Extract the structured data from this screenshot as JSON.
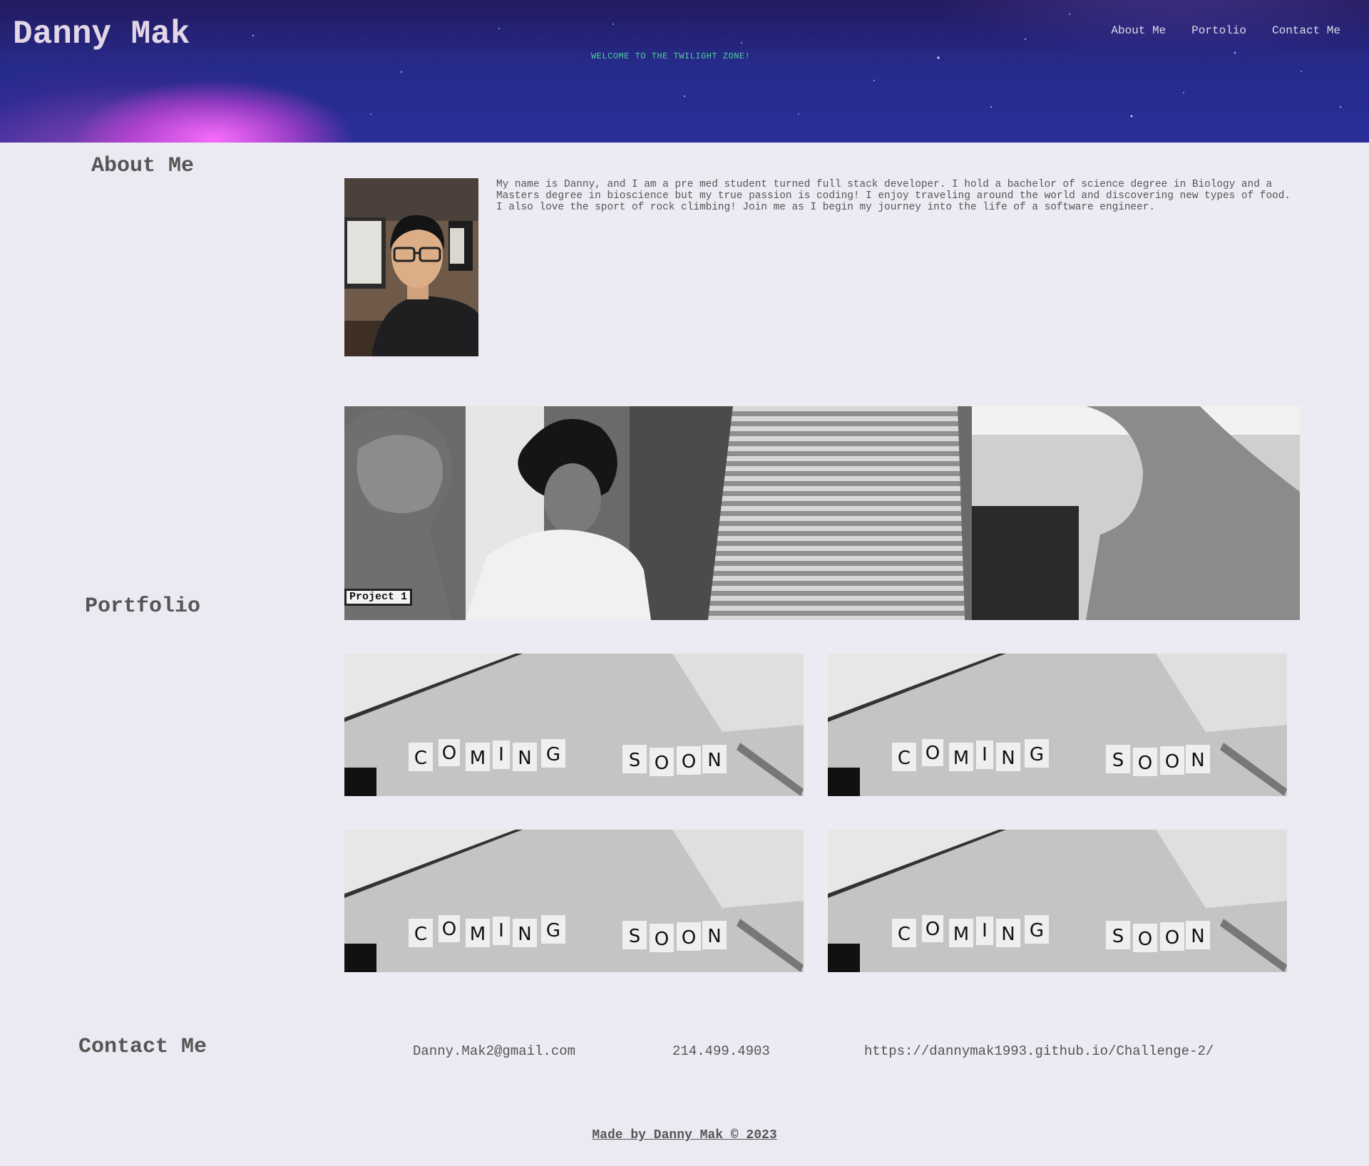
{
  "header": {
    "site_name": "Danny Mak",
    "tagline": "WELCOME TO THE TWILIGHT ZONE!",
    "nav": [
      {
        "label": "About Me"
      },
      {
        "label": "Portolio"
      },
      {
        "label": "Contact Me"
      }
    ]
  },
  "about": {
    "heading": "About Me",
    "bio": "My name is Danny, and I am a pre med student turned full stack developer. I hold a bachelor of science degree in Biology and a Masters degree in bioscience but my true passion is coding! I enjoy traveling around the world and discovering new types of food. I also love the sport of rock climbing! Join me as I begin my journey into the life of a software engineer."
  },
  "portfolio": {
    "heading": "Portfolio",
    "featured": {
      "label": "Project 1"
    },
    "placeholder_text": [
      "COMING",
      "SOON"
    ]
  },
  "contact": {
    "heading": "Contact Me",
    "email": "Danny.Mak2@gmail.com",
    "phone": "214.499.4903",
    "url": "https://dannymak1993.github.io/Challenge-2/"
  },
  "footer": {
    "text": "Made by Danny Mak © 2023"
  },
  "colors": {
    "page_background": "#ebeaf2",
    "header_background": "#262a8a",
    "tagline": "#4ed09a",
    "text": "#555555"
  }
}
